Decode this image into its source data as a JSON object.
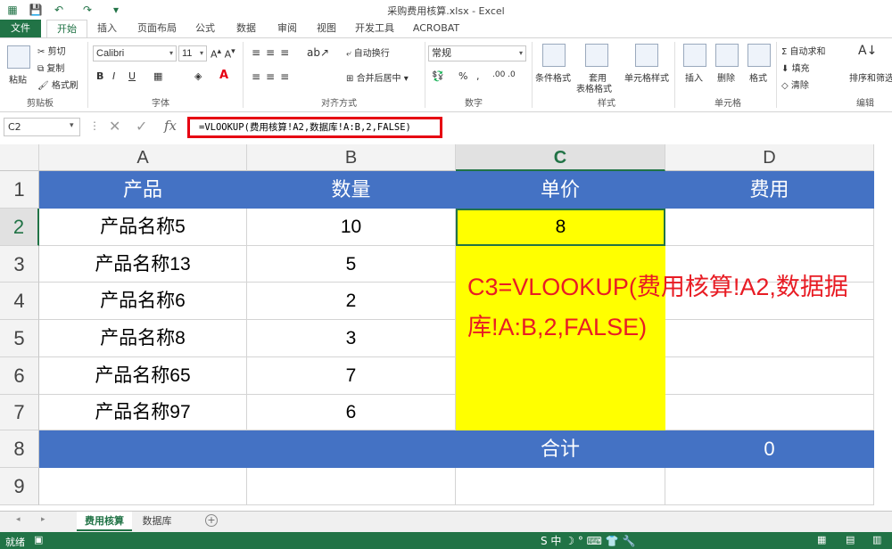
{
  "window": {
    "title": "采购费用核算.xlsx - Excel"
  },
  "ribbon_tabs": [
    "文件",
    "开始",
    "插入",
    "页面布局",
    "公式",
    "数据",
    "审阅",
    "视图",
    "开发工具",
    "ACROBAT"
  ],
  "ribbon": {
    "clipboard": {
      "paste": "粘贴",
      "cut": "剪切",
      "copy": "复制",
      "format_painter": "格式刷",
      "label": "剪贴板"
    },
    "font": {
      "name": "Calibri",
      "size": "11",
      "label": "字体",
      "bold": "B",
      "italic": "I",
      "underline": "U"
    },
    "alignment": {
      "wrap": "自动换行",
      "merge": "合并后居中",
      "label": "对齐方式"
    },
    "number": {
      "format": "常规",
      "percent": "%",
      "comma": ",",
      "label": "数字"
    },
    "styles": {
      "conditional": "条件格式",
      "table_line1": "套用",
      "table_line2": "表格格式",
      "cell_styles": "单元格样式",
      "label": "样式"
    },
    "cells": {
      "insert": "插入",
      "delete": "删除",
      "format": "格式",
      "label": "单元格"
    },
    "editing": {
      "autosum": "自动求和",
      "fill": "填充",
      "clear": "清除",
      "sort": "排序和筛选",
      "label": "编辑"
    }
  },
  "formula_bar": {
    "name_box": "C2",
    "formula": "=VLOOKUP(费用核算!A2,数据库!A:B,2,FALSE)"
  },
  "columns": [
    "A",
    "B",
    "C",
    "D"
  ],
  "rows": [
    "1",
    "2",
    "3",
    "4",
    "5",
    "6",
    "7",
    "8",
    "9"
  ],
  "table": {
    "headers": [
      "产品",
      "数量",
      "单价",
      "费用"
    ],
    "data": [
      [
        "产品名称5",
        "10",
        "8"
      ],
      [
        "产品名称13",
        "5",
        ""
      ],
      [
        "产品名称6",
        "2",
        ""
      ],
      [
        "产品名称8",
        "3",
        ""
      ],
      [
        "产品名称65",
        "7",
        ""
      ],
      [
        "产品名称97",
        "6",
        ""
      ]
    ],
    "total_label": "合计",
    "total_value": "0"
  },
  "annotation": {
    "line1": "C3=VLOOKUP(费用核算!A2,数据据",
    "line2": "库!A:B,2,FALSE)"
  },
  "sheets": [
    "费用核算",
    "数据库"
  ],
  "status": {
    "ready": "就绪"
  },
  "colors": {
    "excel_green": "#217346",
    "header_blue": "#4472c4",
    "highlight_yellow": "#ffff00",
    "annotation_red": "#e81c24"
  }
}
